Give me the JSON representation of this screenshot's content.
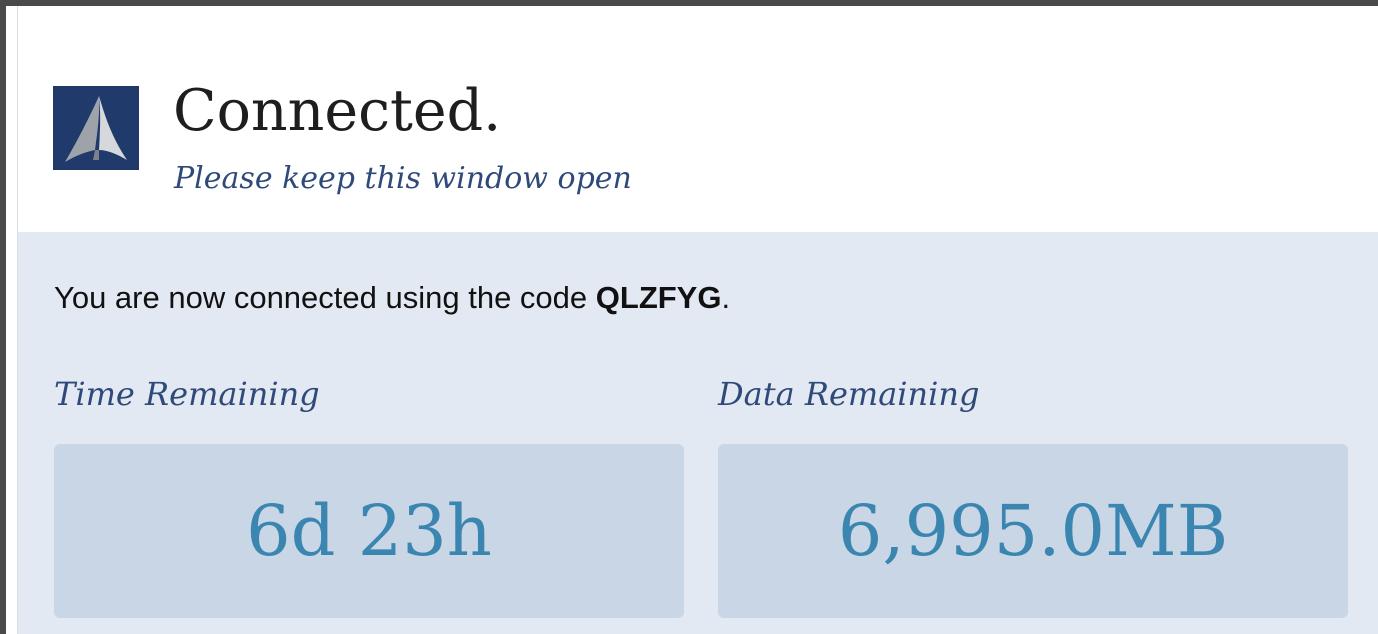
{
  "header": {
    "logo_icon": "sail-logo-icon",
    "title": "Connected.",
    "subtitle": "Please keep this window open"
  },
  "connection": {
    "message_prefix": "You are now connected using the code ",
    "code": "QLZFYG",
    "message_suffix": "."
  },
  "stats": {
    "time_label": "Time Remaining",
    "time_value": "6d 23h",
    "data_label": "Data Remaining",
    "data_value": "6,995.0MB"
  },
  "colors": {
    "logo_background": "#1f3a6b",
    "accent_text": "#2f4a7a",
    "value_text": "#3b86b0",
    "panel_background": "#e3e9f2",
    "box_background": "#c8d6e6"
  }
}
